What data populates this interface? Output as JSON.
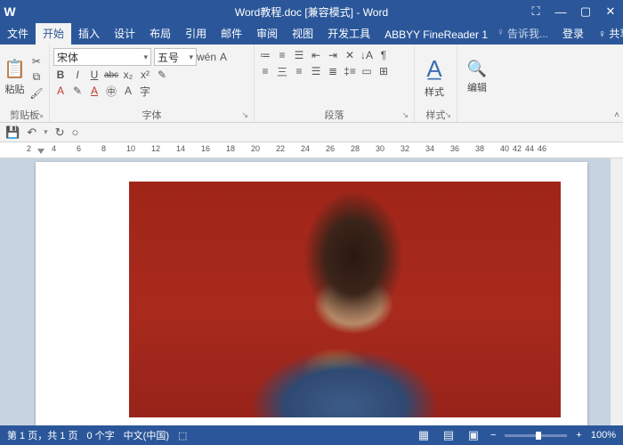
{
  "title": {
    "doc": "Word教程.doc",
    "mode": "[兼容模式]",
    "app": "Word"
  },
  "window": {
    "min": "—",
    "max": "▢",
    "close": "✕",
    "help": "⛶"
  },
  "tabs": {
    "file": "文件",
    "home": "开始",
    "insert": "插入",
    "design": "设计",
    "layout": "布局",
    "ref": "引用",
    "mail": "邮件",
    "review": "审阅",
    "view": "视图",
    "dev": "开发工具",
    "finereader": "ABBYY FineReader 1",
    "tell": "告诉我...",
    "login": "登录",
    "share": "共享"
  },
  "ribbon": {
    "clipboard": {
      "label": "剪贴板",
      "paste": "粘贴"
    },
    "font": {
      "label": "字体",
      "family": "宋体",
      "size": "五号",
      "bold": "B",
      "italic": "I",
      "underline": "U",
      "strike": "abc",
      "sub": "x₂",
      "sup": "x²",
      "clear": "✎"
    },
    "paragraph": {
      "label": "段落"
    },
    "styles": {
      "label": "样式",
      "btn": "样式"
    },
    "editing": {
      "label": "",
      "btn": "编辑"
    }
  },
  "qat": {
    "save": "💾",
    "undo": "↶",
    "redo": "↻",
    "preview": "○"
  },
  "ruler": {
    "marks": [
      "2",
      "",
      "4",
      "",
      "6",
      "",
      "8",
      "",
      "10",
      "",
      "12",
      "",
      "14",
      "",
      "16",
      "",
      "18",
      "",
      "20",
      "",
      "22",
      "",
      "24",
      "",
      "26",
      "",
      "28",
      "",
      "30",
      "",
      "32",
      "",
      "34",
      "",
      "36",
      "",
      "38",
      "",
      "40",
      "42",
      "44",
      "46"
    ]
  },
  "status": {
    "page": "第 1 页，共 1 页",
    "words": "0 个字",
    "lang": "中文(中国)",
    "zoom": "100%",
    "minus": "−",
    "plus": "+"
  }
}
